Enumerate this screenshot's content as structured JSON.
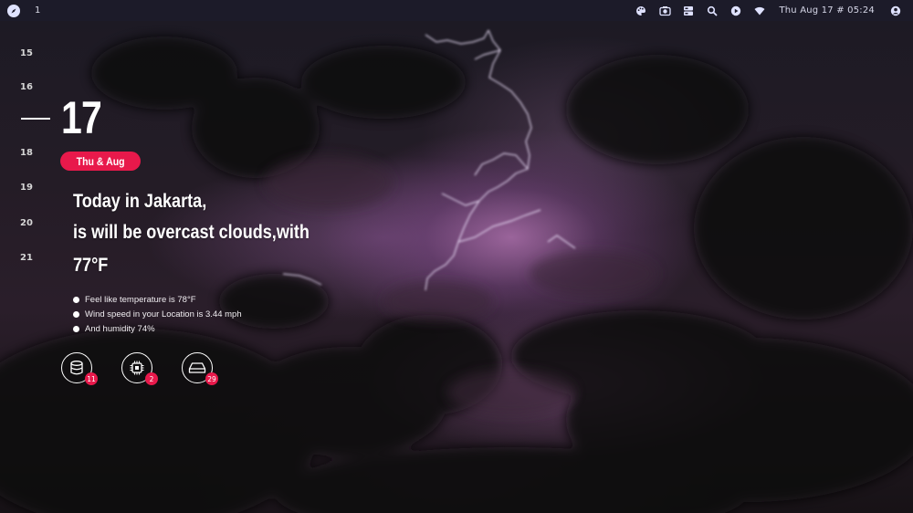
{
  "topbar": {
    "workspace": "1",
    "clock": "Thu Aug 17 # 05:24",
    "icons": [
      "palette-icon",
      "camera-icon",
      "panel-icon",
      "search-icon",
      "play-icon",
      "wifi-icon",
      "user-icon"
    ]
  },
  "timeline": {
    "days": [
      "15",
      "16",
      "18",
      "19",
      "20",
      "21"
    ],
    "current_day": "17",
    "date_label": "Thu & Aug"
  },
  "weather": {
    "line1": "Today in Jakarta,",
    "line2": "is will be overcast clouds,with",
    "line3": "77°F",
    "details": [
      "Feel like temperature is 78°F",
      "Wind speed in your Location is 3.44 mph",
      "And humidity 74%"
    ]
  },
  "stats": [
    {
      "icon": "database-icon",
      "value": "11"
    },
    {
      "icon": "cpu-icon",
      "value": "2"
    },
    {
      "icon": "drive-icon",
      "value": "29"
    }
  ],
  "colors": {
    "accent": "#e8194b",
    "topbar": "#1c1b29",
    "icon": "#dfe2ff"
  }
}
